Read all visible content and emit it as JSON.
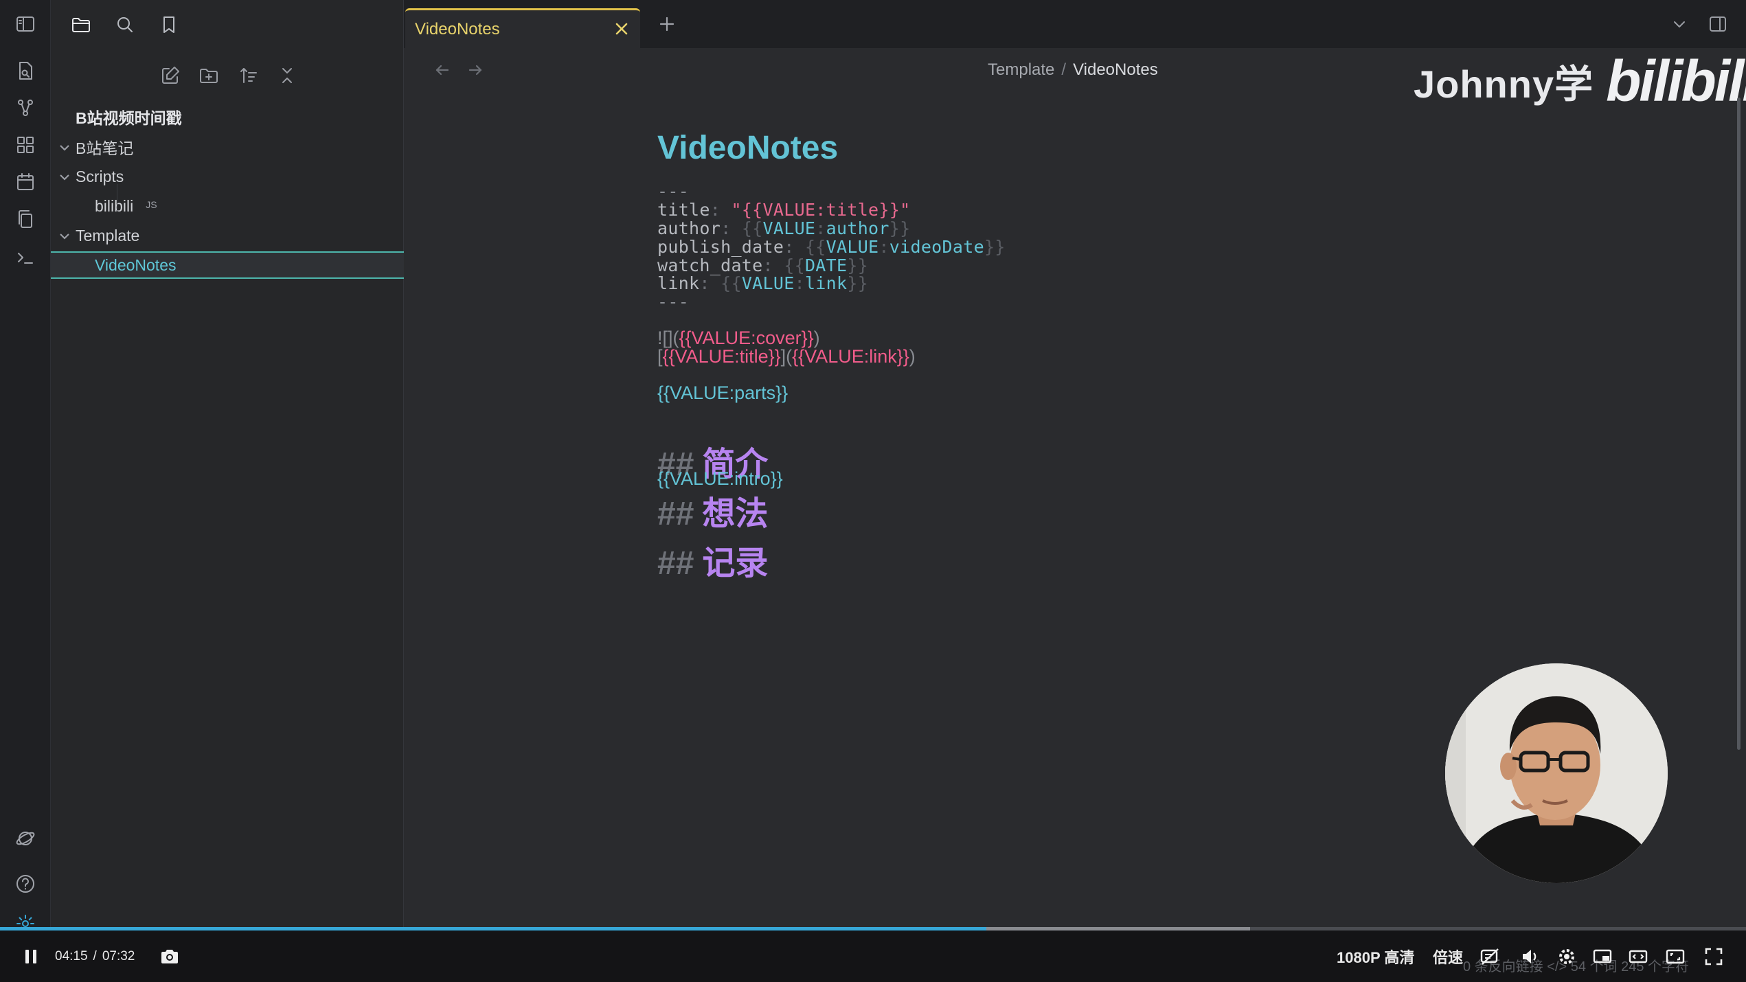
{
  "tab": {
    "title": "VideoNotes"
  },
  "breadcrumb": {
    "parent": "Template",
    "separator": "/",
    "current": "VideoNotes"
  },
  "watermark": {
    "text": "Johnny学",
    "logo": "bilibili"
  },
  "explorer": {
    "vault_name": "B站视频时间戳",
    "items": [
      {
        "label": "B站笔记"
      },
      {
        "label": "Scripts"
      },
      {
        "label": "bilibili",
        "badge": "JS"
      },
      {
        "label": "Template"
      },
      {
        "label": "VideoNotes"
      }
    ]
  },
  "document": {
    "title": "VideoNotes",
    "fm_delim": "---",
    "frontmatter": [
      {
        "key": "title",
        "colon": ":",
        "value": "\"{{VALUE:title}}\""
      },
      {
        "key": "author",
        "colon": ":",
        "open": "{{",
        "var": "VALUE",
        "sep": ":",
        "name": "author",
        "close": "}}"
      },
      {
        "key": "publish_date",
        "colon": ":",
        "open": "{{",
        "var": "VALUE",
        "sep": ":",
        "name": "videoDate",
        "close": "}}"
      },
      {
        "key": "watch_date",
        "colon": ":",
        "open": "{{",
        "var": "DATE",
        "close": "}}"
      },
      {
        "key": "link",
        "colon": ":",
        "open": "{{",
        "var": "VALUE",
        "sep": ":",
        "name": "link",
        "close": "}}"
      }
    ],
    "cover_line": {
      "prefix": "![](",
      "value": "{{VALUE:cover}}",
      "suffix": ")"
    },
    "link_line": {
      "open": "[",
      "text": "{{VALUE:title}}",
      "mid": "](",
      "url": "{{VALUE:link}}",
      "close": ")"
    },
    "parts_line": "{{VALUE:parts}}",
    "headings": [
      {
        "hash": "##",
        "text": "简介"
      },
      {
        "hash": "##",
        "text": "想法"
      },
      {
        "hash": "##",
        "text": "记录"
      }
    ],
    "intro_line": "{{VALUE:intro}}"
  },
  "tooltip": "设置",
  "player": {
    "progress": 0.565,
    "current_time": "04:15",
    "time_sep": "/",
    "total_time": "07:32",
    "quality": "1080P 高清",
    "speed": "倍速",
    "ghost_text": "0 条反向链接  </>  54 个词  245 个字符"
  }
}
